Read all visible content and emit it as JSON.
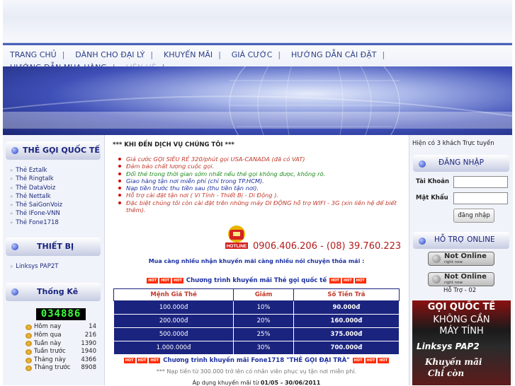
{
  "nav": {
    "items": [
      "TRANG CHỦ",
      "DÀNH CHO ĐẠI LÝ",
      "KHUYẾN MÃI",
      "GIÁ CƯỚC",
      "HƯỚNG DẪN CÀI ĐẶT",
      "HƯỚNG DẪN MUA HÀNG",
      "LIÊN HỆ"
    ]
  },
  "left": {
    "cards_title": "THẺ GỌI QUỐC TẾ",
    "cards": [
      "Thẻ Eztalk",
      "Thẻ Ringtalk",
      "Thẻ DataVoiz",
      "Thẻ Nettalk",
      "Thẻ SaiGonVoiz",
      "Thẻ IFone-VNN",
      "Thẻ Fone1718"
    ],
    "devices_title": "THIẾT BỊ",
    "devices": [
      "Linksys PAP2T"
    ],
    "stats_title": "Thống Kê",
    "counter": "034886",
    "stats": [
      {
        "label": "Hôm nay",
        "value": "14"
      },
      {
        "label": "Hôm qua",
        "value": "216"
      },
      {
        "label": "Tuần này",
        "value": "1390"
      },
      {
        "label": "Tuần trước",
        "value": "1940"
      },
      {
        "label": "Tháng này",
        "value": "4366"
      },
      {
        "label": "Tháng trước",
        "value": "8908"
      }
    ]
  },
  "center": {
    "welcome": "*** KHI ĐẾN DỊCH VỤ CHÚNG TÔI ***",
    "bullets": [
      {
        "text": "Giá cước GỌI SIÊU RẺ 320/phút gọi USA-CANADA (đã có VAT)",
        "color": "#c0392b"
      },
      {
        "text": "Đảm bảo chất lượng cuộc gọi.",
        "color": "#c0392b"
      },
      {
        "text": "Đổi thẻ trong thời gian sớm nhất nếu thẻ gọi không được, không rõ.",
        "color": "#1e8a1e"
      },
      {
        "text": "Giao hàng tận nơi miễn phí (chỉ trong TP.HCM).",
        "color": "#1b2fa0"
      },
      {
        "text": "Nạp tiền trước thu tiền sau (thu tiền tận nơi).",
        "color": "#1b2fa0"
      },
      {
        "text": "Hỗ trợ cài đặt tận nơi ( Vi Tính - Thiết Bị - Di Động ).",
        "color": "#c0392b"
      },
      {
        "text": "Đặc biệt chúng tôi còn cài đặt trên những máy DI ĐỘNG hỗ trợ WIFI - 3G (xin liên hệ để biết thêm).",
        "color": "#c0392b"
      }
    ],
    "hotline_label": "HOTLINE",
    "phone": "0906.406.206 - (08) 39.760.223",
    "promo1": "Mua càng nhiều nhận khuyến mãi càng nhiều nói chuyện thỏa mái :",
    "hot_badge": "HOT",
    "promo2": "Chương trình khuyến mãi Thẻ gọi quốc tế",
    "table": {
      "headers": [
        "Mệnh Giá Thẻ",
        "Giảm",
        "Số Tiền Trả"
      ],
      "rows": [
        [
          "100.000đ",
          "10%",
          "90.000đ"
        ],
        [
          "200.000đ",
          "20%",
          "160.000đ"
        ],
        [
          "500.000đ",
          "25%",
          "375.000đ"
        ],
        [
          "1.000.000đ",
          "30%",
          "700.000đ"
        ]
      ]
    },
    "promo3": "Chương trình khuyến mãi Fone1718 \"THẺ GỌI ĐẠI TRÀ\"",
    "note": "*** Nạp tiền từ 300.000 trở lên có nhân viên phục vụ tận nơi miễn phí.",
    "apdung_prefix": "Áp dụng khuyến mãi từ ",
    "apdung_dates": "01/05 - 30/06/2011"
  },
  "right": {
    "online_text": "Hiện có 3 khách Trực tuyến",
    "login_title": "ĐĂNG NHẬP",
    "username_label": "Tài Khoản",
    "password_label": "Mật Khẩu",
    "login_button": "đăng nhập",
    "support_title": "HỖ TRỢ ONLINE",
    "status_main": "Not Online",
    "status_sub": "right now",
    "support_label": "Hỗ Trợ - 02",
    "ad": {
      "line1": "GỌI QUỐC TẾ",
      "line2": "KHÔNG CẦN",
      "line3": "MÁY TÍNH",
      "line4": "Linksys PAP2",
      "line5": "Khuyến mãi",
      "line6": "Chỉ còn"
    }
  },
  "colors": {
    "accent": "#1a237e",
    "price_red": "#c0392b",
    "counter_green": "#3cff3c"
  }
}
